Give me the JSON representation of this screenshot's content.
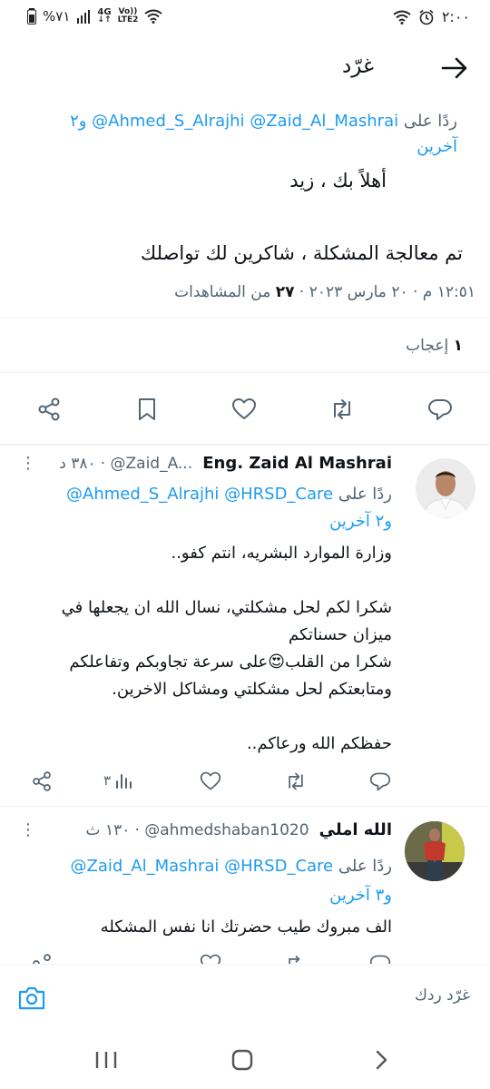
{
  "status_bar": {
    "time": "٢:٠٠",
    "battery": "%٧١",
    "network": "4G",
    "volte_top": "Vo))",
    "volte_bottom": "LTE2"
  },
  "header": {
    "title": "غرّد"
  },
  "main_tweet": {
    "replying_to_label": "ردًا على",
    "replying_to_handles": "@Ahmed_S_Alrajhi @Zaid_Al_Mashrai",
    "replying_to_more": "و٢",
    "replying_to_more2": "آخرين",
    "body_line1": "أهلاً بك ، زيد",
    "body_line2": "تم معالجة المشكلة ، شاكرين لك تواصلك",
    "meta_time": "١٢:٥١ م",
    "meta_date": "٢٠ مارس ٢٠٢٣",
    "meta_views": "٢٧",
    "meta_views_label": "من المشاهدات",
    "likes_count": "١",
    "likes_label": "إعجاب"
  },
  "reply1": {
    "display_name": "Eng. Zaid Al Mashrai",
    "handle": "@Zaid_A...",
    "time": "٣٨٠ د",
    "replying_to_label": "ردًا على",
    "replying_to_handles": "@Ahmed_S_Alrajhi @HRSD_Care",
    "replying_to_more": "و٢ آخرين",
    "lines": [
      "وزارة الموارد البشريه، انتم كفو..",
      "شكرا لكم لحل مشكلتي، نسال الله ان يجعلها في",
      "ميزان حسناتكم",
      "شكرا من القلب😍على سرعة تجاوبكم وتفاعلكم",
      "ومتابعتكم لحل مشكلتي ومشاكل الاخرين.",
      "حفظكم الله ورعاكم.."
    ],
    "views": "٣"
  },
  "reply2": {
    "display_name": "الله املي",
    "handle": "@ahmedshaban1020",
    "time": "١٣٠ ث",
    "replying_to_label": "ردًا على",
    "replying_to_handles": "@Zaid_Al_Mashrai @HRSD_Care",
    "replying_to_more": "و٣ آخرين",
    "body": "الف مبروك طيب حضرتك انا نفس المشكله"
  },
  "compose": {
    "placeholder": "غرّد ردك"
  },
  "colors": {
    "accent": "#1d9bf0",
    "text": "#0f1419",
    "muted": "#536471",
    "divider": "#eff3f4"
  },
  "icons": [
    "back-arrow-icon",
    "reply-icon",
    "retweet-icon",
    "like-icon",
    "bookmark-icon",
    "share-icon",
    "views-icon",
    "more-icon",
    "camera-icon",
    "recents-icon",
    "home-icon",
    "back-icon"
  ]
}
